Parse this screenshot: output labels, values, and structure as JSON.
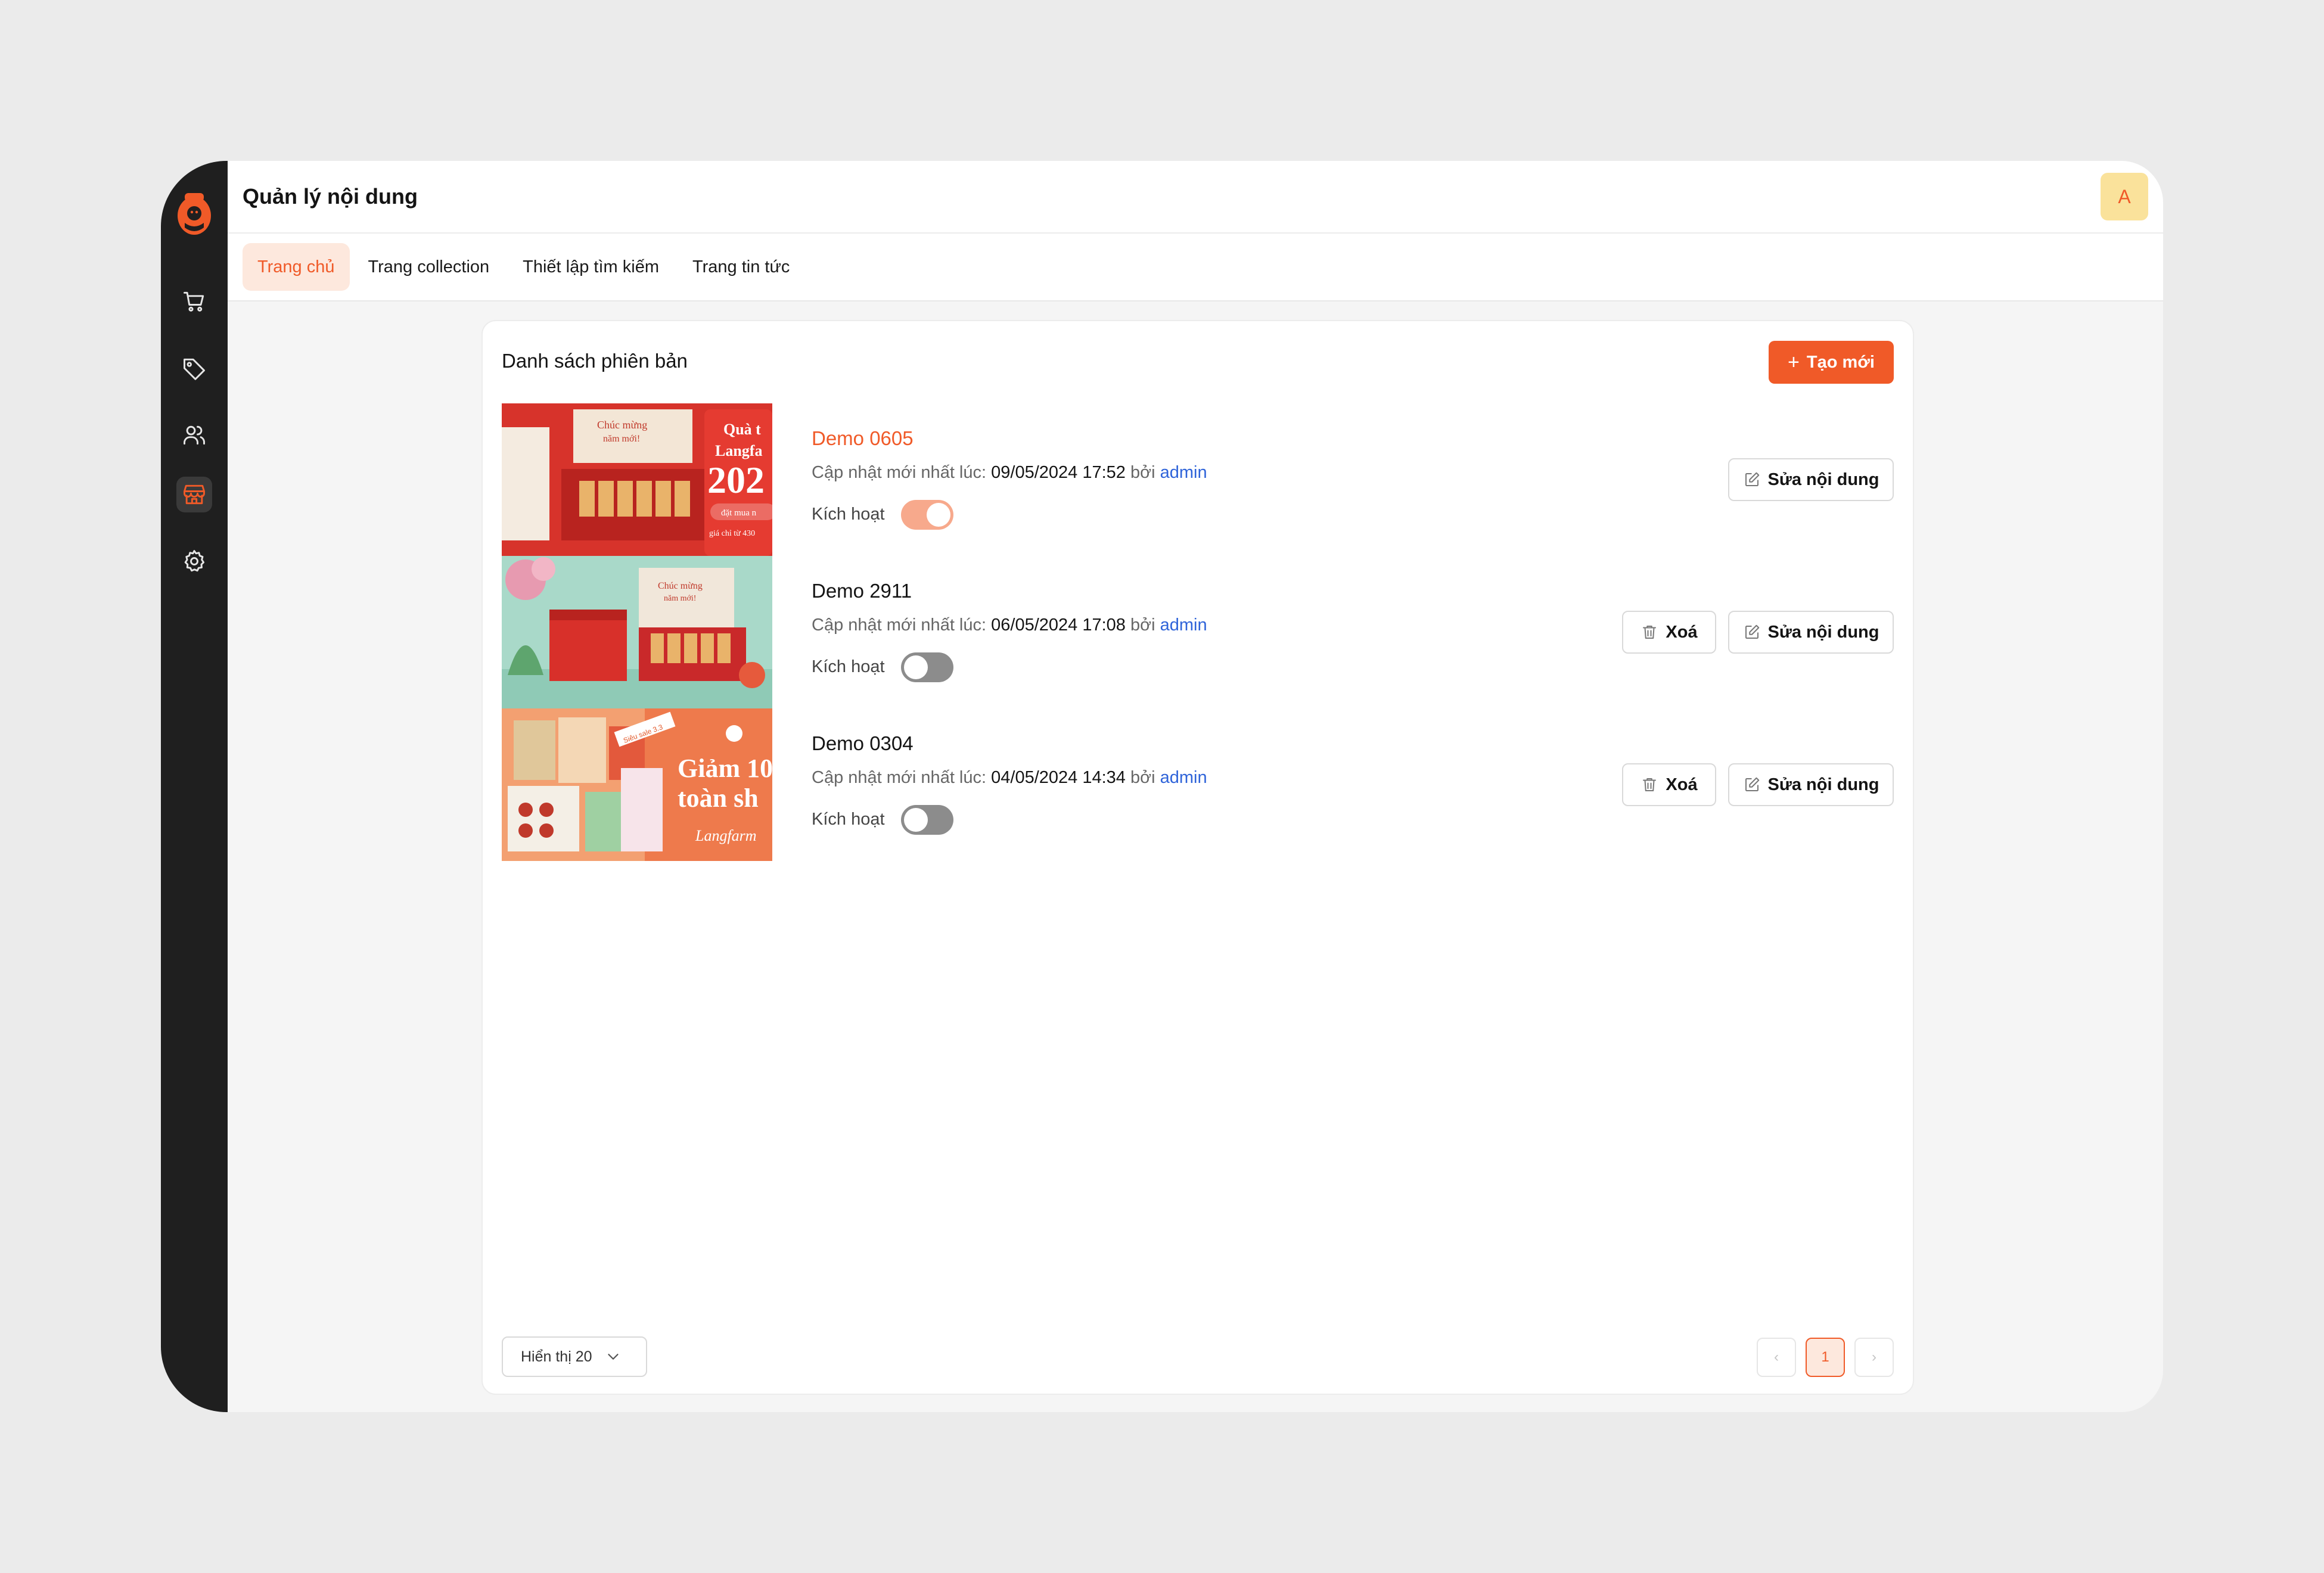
{
  "header": {
    "title": "Quản lý nội dung",
    "avatar_initial": "A"
  },
  "sidebar": {
    "items": [
      {
        "name": "cart-icon",
        "active": false
      },
      {
        "name": "tag-icon",
        "active": false
      },
      {
        "name": "users-icon",
        "active": false
      },
      {
        "name": "storefront-icon",
        "active": true
      },
      {
        "name": "gear-icon",
        "active": false
      }
    ]
  },
  "tabs": [
    {
      "label": "Trang chủ",
      "active": true
    },
    {
      "label": "Trang collection",
      "active": false
    },
    {
      "label": "Thiết lập tìm kiếm",
      "active": false
    },
    {
      "label": "Trang tin tức",
      "active": false
    }
  ],
  "list": {
    "title": "Danh sách phiên bản",
    "create_label": "Tạo mới",
    "meta_prefix": "Cập nhật mới nhất lúc:",
    "by_label": "bởi",
    "active_label": "Kích hoạt",
    "delete_label": "Xoá",
    "edit_label": "Sửa nội dung",
    "versions": [
      {
        "name": "Demo 0605",
        "updated_at": "09/05/2024 17:52",
        "updated_by": "admin",
        "active": true,
        "banner_text": [
          "Chúc mừng",
          "năm mới!",
          "Quà t",
          "Langfa",
          "202",
          "đặt mua n",
          "giá chỉ từ 430"
        ]
      },
      {
        "name": "Demo 2911",
        "updated_at": "06/05/2024 17:08",
        "updated_by": "admin",
        "active": false,
        "banner_text": [
          "Chúc mừng",
          "năm mới!"
        ]
      },
      {
        "name": "Demo 0304",
        "updated_at": "04/05/2024 14:34",
        "updated_by": "admin",
        "active": false,
        "banner_text": [
          "Siêu sale 3.3",
          "Giảm 10",
          "toàn sh",
          "Langfarm"
        ]
      }
    ]
  },
  "footer": {
    "page_size_label": "Hiển thị 20",
    "current_page": "1",
    "prev": "‹",
    "next": "›"
  },
  "colors": {
    "accent": "#f05a28",
    "sidebar_bg": "#1f1f1f",
    "link": "#2e63d9",
    "avatar_bg": "#fae29b"
  }
}
